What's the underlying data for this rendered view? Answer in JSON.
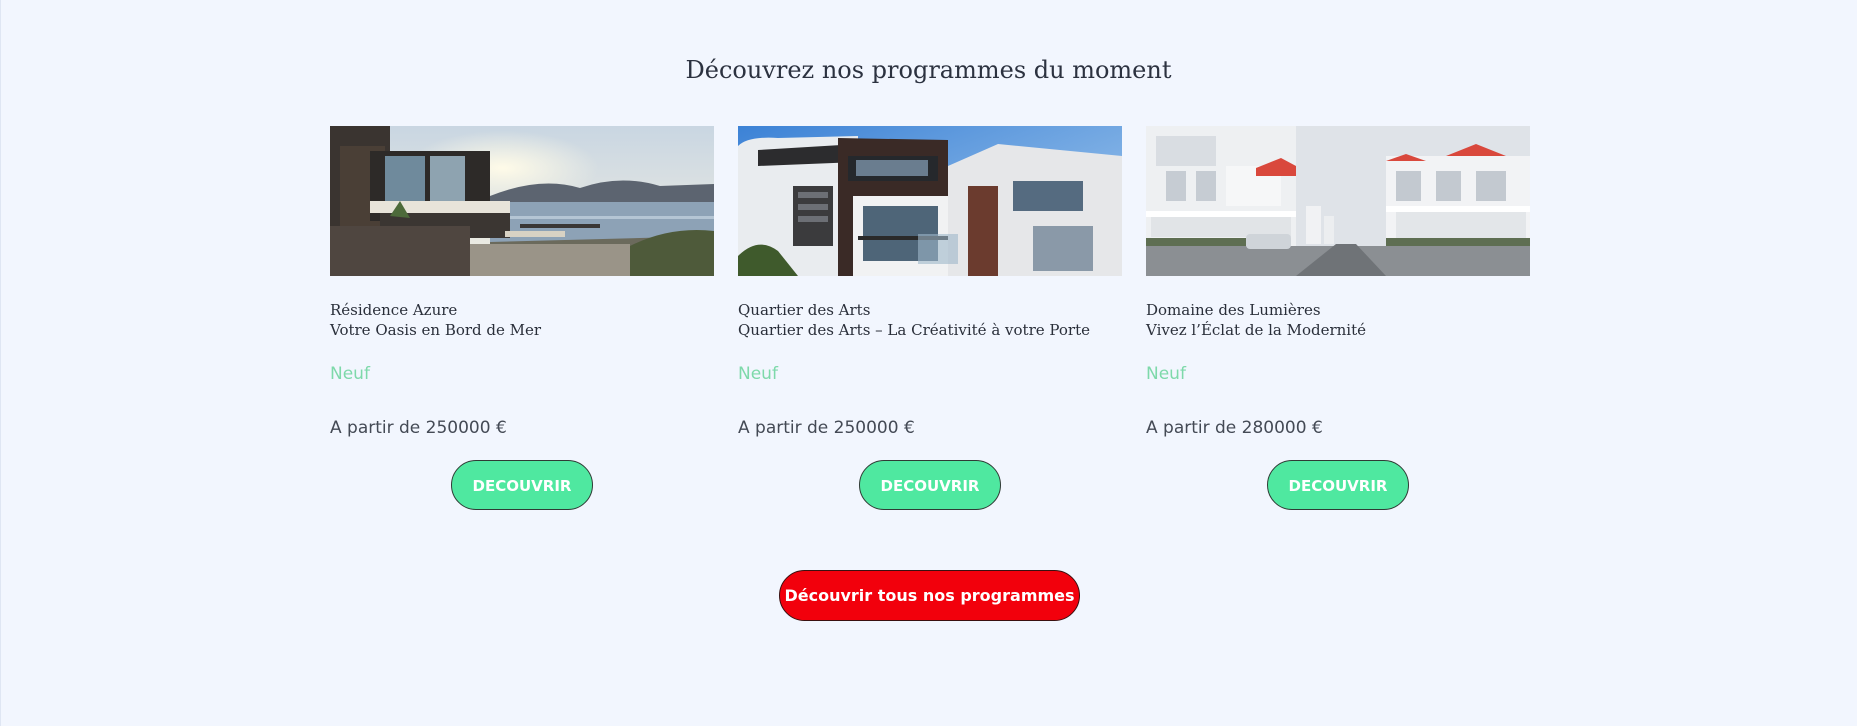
{
  "section": {
    "title": "Découvrez nos programmes du moment"
  },
  "cards": [
    {
      "name": "Résidence Azure",
      "tagline": "Votre Oasis en Bord de Mer",
      "status": "Neuf",
      "price": "A partir de 250000 €",
      "button": "DECOUVRIR",
      "image": "seaside-villa-photo"
    },
    {
      "name": "Quartier des Arts",
      "tagline": "Quartier des Arts – La Créativité à votre Porte",
      "status": "Neuf",
      "price": "A partir de 250000 €",
      "button": "DECOUVRIR",
      "image": "modern-house-photo"
    },
    {
      "name": "Domaine des Lumières",
      "tagline": "Vivez l’Éclat de la Modernité",
      "status": "Neuf",
      "price": "A partir de 280000 €",
      "button": "DECOUVRIR",
      "image": "white-villas-street-photo"
    }
  ],
  "all_programs_button": "Découvrir tous nos programmes",
  "colors": {
    "background": "#f2f6fe",
    "status": "#7ed9aa",
    "discover_button": "#4fe8a0",
    "all_programs_button": "#f2000c"
  }
}
